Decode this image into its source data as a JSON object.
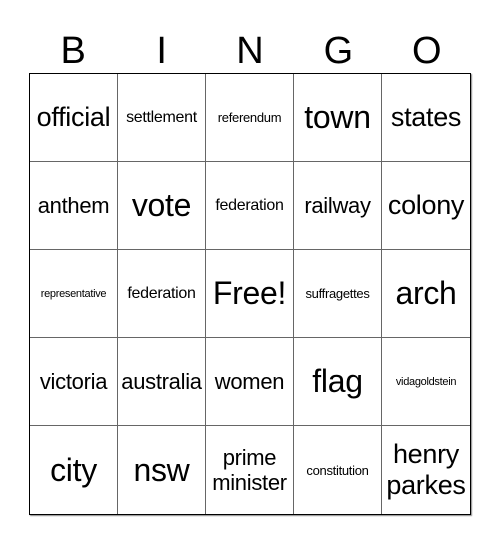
{
  "header": [
    "B",
    "I",
    "N",
    "G",
    "O"
  ],
  "cells": [
    {
      "text": "official",
      "size": "lg"
    },
    {
      "text": "settlement",
      "size": "sm"
    },
    {
      "text": "referendum",
      "size": "xs"
    },
    {
      "text": "town",
      "size": "xl"
    },
    {
      "text": "states",
      "size": "lg"
    },
    {
      "text": "anthem",
      "size": "md"
    },
    {
      "text": "vote",
      "size": "xl"
    },
    {
      "text": "federation",
      "size": "sm"
    },
    {
      "text": "railway",
      "size": "md"
    },
    {
      "text": "colony",
      "size": "lg"
    },
    {
      "text": "representative",
      "size": "xxs"
    },
    {
      "text": "federation",
      "size": "sm"
    },
    {
      "text": "Free!",
      "size": "xl"
    },
    {
      "text": "suffragettes",
      "size": "xs"
    },
    {
      "text": "arch",
      "size": "xl"
    },
    {
      "text": "victoria",
      "size": "md"
    },
    {
      "text": "australia",
      "size": "md"
    },
    {
      "text": "women",
      "size": "md"
    },
    {
      "text": "flag",
      "size": "xl"
    },
    {
      "text": "vidagoldstein",
      "size": "xxs"
    },
    {
      "text": "city",
      "size": "xl"
    },
    {
      "text": "nsw",
      "size": "xl"
    },
    {
      "text": "prime minister",
      "size": "md",
      "wrap": true
    },
    {
      "text": "constitution",
      "size": "xs"
    },
    {
      "text": "henry parkes",
      "size": "lg",
      "wrap": true
    }
  ]
}
